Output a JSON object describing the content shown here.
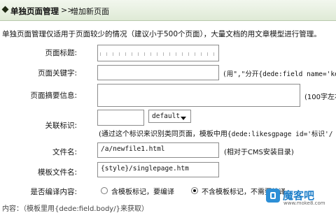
{
  "header": {
    "title": "单独页面管理",
    "separator": ">>",
    "crumb": "增加新页面"
  },
  "description": "单独页面管理仅适用于页面较少的情况（建议小于500个页面），大量文档的用文章模型进行管理。",
  "form": {
    "page_title": {
      "label": "页面标题:",
      "value": ""
    },
    "keywords": {
      "label": "页面关键字:",
      "value": "",
      "hint": "(用\",\"分开{dede:field name='key"
    },
    "summary": {
      "label": "页面摘要信息:",
      "value": "",
      "hint": "(100字左右"
    },
    "like_id": {
      "label": "关联标识:",
      "value": "",
      "select_value": "default",
      "hint_prefix": "(通过这个标识来识别类同页面，模板中用",
      "hint_code": "{dede:likesgpage id='标识'/"
    },
    "filename": {
      "label": "文件名:",
      "value": "/a/newfile1.html",
      "hint": "(相对于CMS安装目录)"
    },
    "template": {
      "label": "模板文件名:",
      "value": "{style}/singlepage.htm"
    },
    "compile": {
      "label": "是否编译内容:",
      "option_1": "含模板标记，要编译",
      "option_2": "不含模板标记，不需要编译"
    }
  },
  "footer_partial": "内容：（模板里用{dede:field.body/}来获取）",
  "watermark": {
    "name": "魔客吧",
    "url": "www.moke8.com"
  },
  "colors": {
    "header_bg": "#e6eedf",
    "accent": "#2d8fd6"
  }
}
